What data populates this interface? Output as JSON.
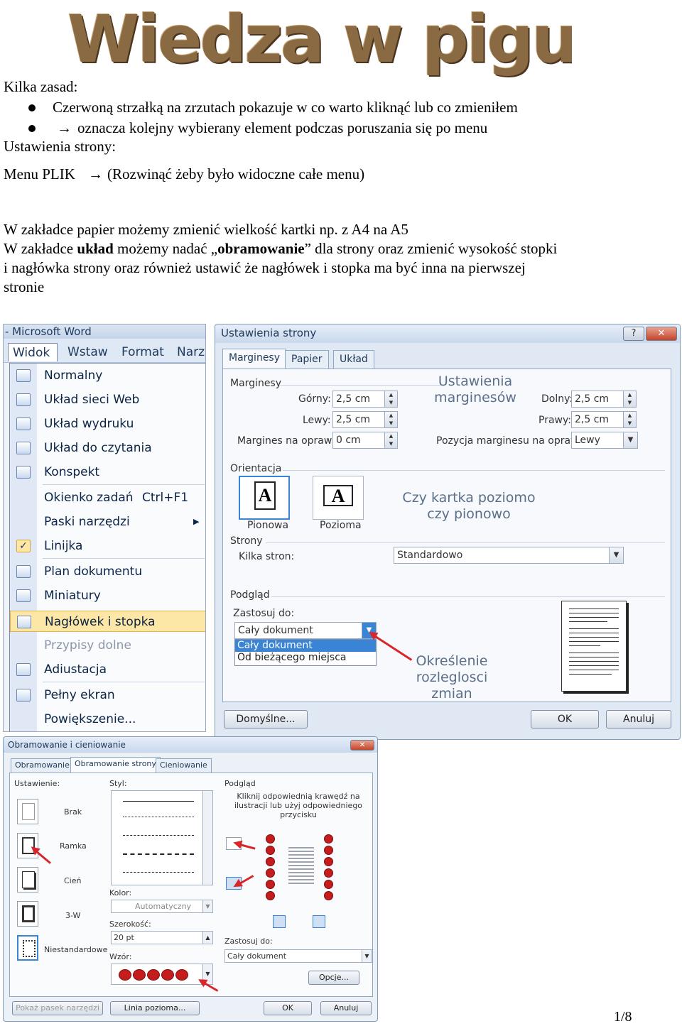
{
  "header": {
    "title": "Wiedza w pigułce:"
  },
  "intro": {
    "heading": "Kilka zasad:",
    "rule1": "Czerwoną strzałką na zrzutach pokazuje w co warto kliknąć lub co zmieniłem",
    "rule2_arrow": "→",
    "rule2": "oznacza kolejny wybierany element podczas poruszania się po menu",
    "section": "Ustawienia strony:",
    "menu_line_start": "Menu PLIK",
    "menu_line_arrow": "→",
    "menu_line_end": "(Rozwinąć żeby było widoczne całe menu)",
    "para1": "W zakładce papier możemy zmienić wielkość kartki np. z A4 na A5",
    "para2_a": "W zakładce ",
    "para2_b": "układ",
    "para2_c": " możemy nadać „",
    "para2_d": "obramowanie",
    "para2_e": "” dla strony oraz zmienić wysokość stopki",
    "para3": "i nagłówka strony oraz również ustawić że nagłówek i stopka ma być inna na pierwszej",
    "para4": "stronie"
  },
  "word_menu": {
    "window_title": "- Microsoft Word",
    "menubar": [
      "Widok",
      "Wstaw",
      "Format",
      "Narz"
    ],
    "items": [
      "Normalny",
      "Układ sieci Web",
      "Układ wydruku",
      "Układ do czytania",
      "Konspekt",
      "Okienko zadań",
      "Paski narzędzi",
      "Linijka",
      "Plan dokumentu",
      "Miniatury",
      "Nagłówek i stopka",
      "Przypisy dolne",
      "Adiustacja",
      "Pełny ekran",
      "Powiększenie..."
    ],
    "shortcut": "Ctrl+F1",
    "submenu_arrow": "▶",
    "check": "✓"
  },
  "page_setup": {
    "title": "Ustawienia strony",
    "help": "?",
    "close": "✕",
    "tabs": [
      "Marginesy",
      "Papier",
      "Układ"
    ],
    "margins_heading": "Marginesy",
    "top_label": "Górny:",
    "top_value": "2,5 cm",
    "left_label": "Lewy:",
    "left_value": "2,5 cm",
    "gutter_label": "Margines na oprawę:",
    "gutter_value": "0 cm",
    "bottom_label": "Dolny:",
    "bottom_value": "2,5 cm",
    "right_label": "Prawy:",
    "right_value": "2,5 cm",
    "gutter_pos_label": "Pozycja marginesu na oprawę:",
    "gutter_pos_value": "Lewy",
    "annot_margins": "Ustawienia marginesów",
    "orientation_heading": "Orientacja",
    "portrait": "Pionowa",
    "landscape": "Pozioma",
    "page_glyph": "A",
    "annot_orientation": "Czy kartka poziomo czy pionowo",
    "pages_heading": "Strony",
    "pages_label": "Kilka stron:",
    "pages_value": "Standardowo",
    "preview_heading": "Podgląd",
    "apply_label": "Zastosuj do:",
    "apply_value": "Cały dokument",
    "apply_options": [
      "Cały dokument",
      "Od bieżącego miejsca"
    ],
    "annot_apply": "Określenie rozleglosci zmian",
    "default_btn": "Domyślne...",
    "ok_btn": "OK",
    "cancel_btn": "Anuluj"
  },
  "borders": {
    "title": "Obramowanie i cieniowanie",
    "close": "✕",
    "tabs": [
      "Obramowanie",
      "Obramowanie strony",
      "Cieniowanie"
    ],
    "settings_label": "Ustawienie:",
    "settings": [
      "Brak",
      "Ramka",
      "Cień",
      "3-W",
      "Niestandardowe"
    ],
    "style_label": "Styl:",
    "color_label": "Kolor:",
    "color_value": "Automatyczny",
    "width_label": "Szerokość:",
    "width_value": "20 pt",
    "art_label": "Wzór:",
    "preview_label": "Podgląd",
    "preview_hint": "Kliknij odpowiednią krawędź na ilustracji lub użyj odpowiedniego przycisku",
    "apply_label": "Zastosuj do:",
    "apply_value": "Cały dokument",
    "options_btn": "Opcje...",
    "toolbar_btn": "Pokaż pasek narzędzi",
    "hline_btn": "Linia pozioma...",
    "ok_btn": "OK",
    "cancel_btn": "Anuluj"
  },
  "footer": {
    "page": "1/8"
  }
}
